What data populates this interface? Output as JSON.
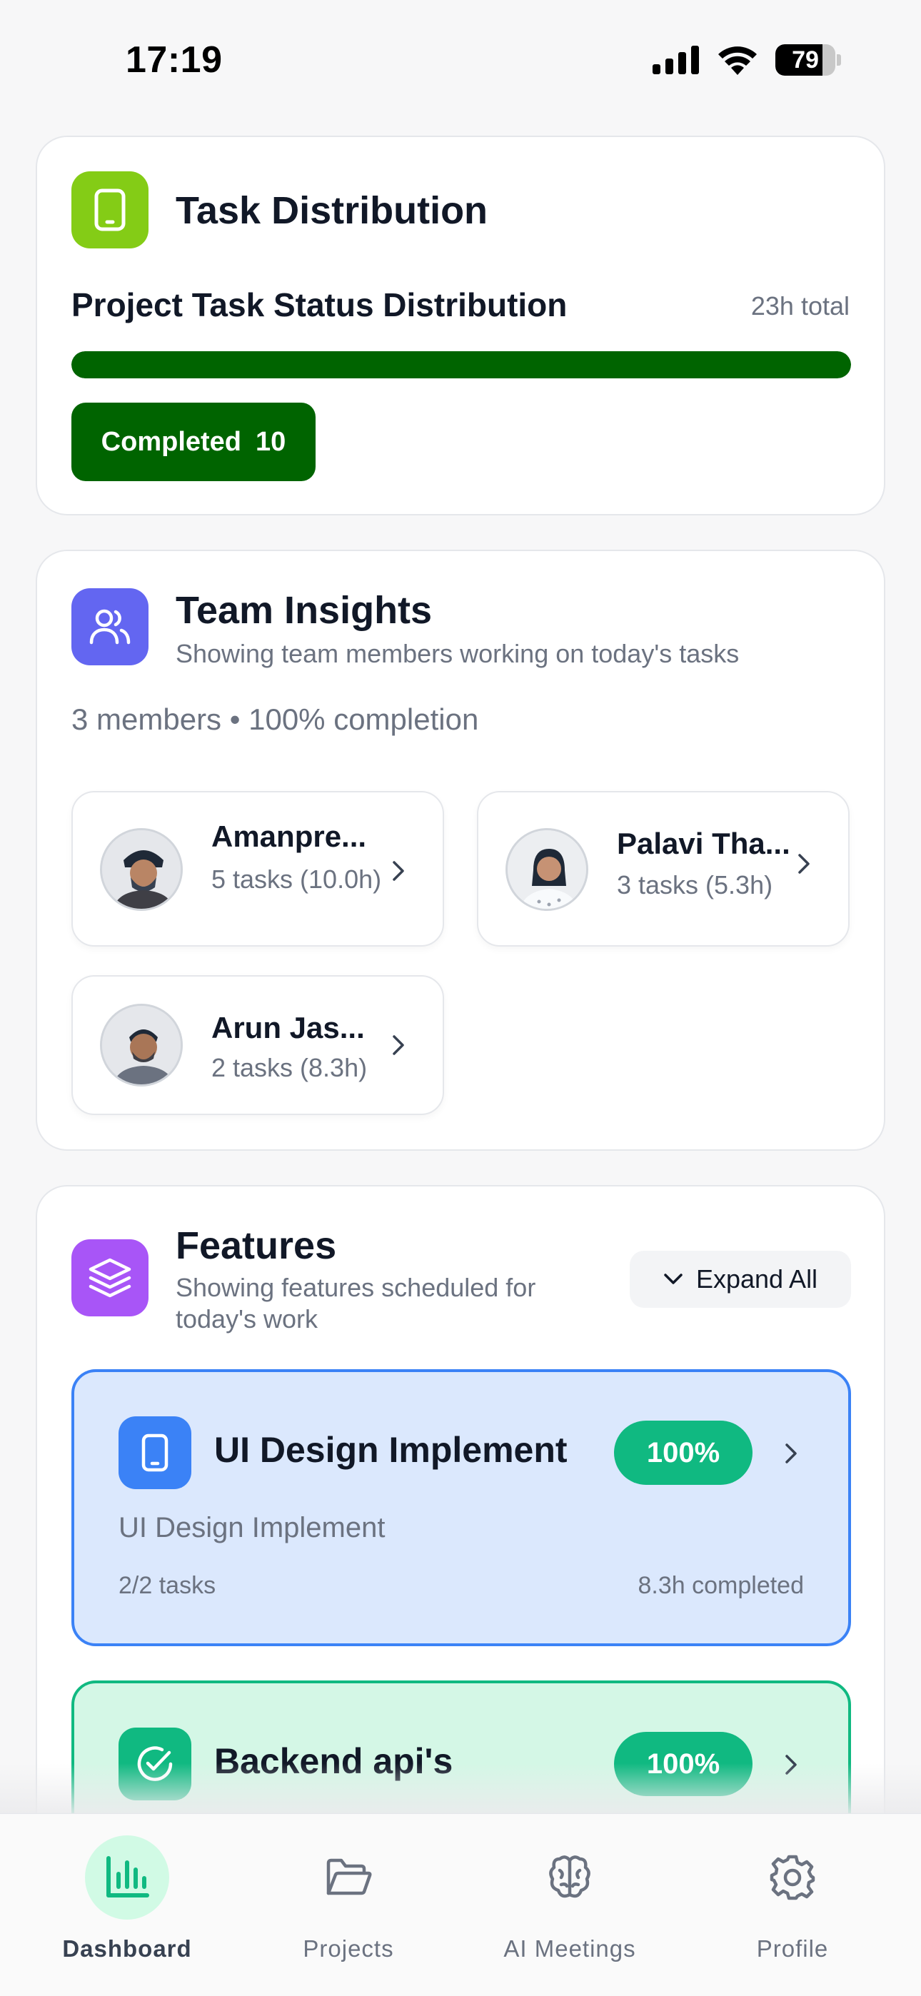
{
  "status_bar": {
    "time": "17:19",
    "battery": "79",
    "battery_level": 0.79
  },
  "task_distribution": {
    "title": "Task Distribution",
    "subtitle": "Project Task Status Distribution",
    "total": "23h total",
    "progress_fraction": 1.0,
    "bar_color": "#006400",
    "badge_label": "Completed",
    "badge_count": "10"
  },
  "team_insights": {
    "title": "Team Insights",
    "subtitle": "Showing team members working on today's tasks",
    "summary": "3 members • 100% completion",
    "members": [
      {
        "name": "Amanpre...",
        "tasks": "5 tasks (10.0h)"
      },
      {
        "name": "Palavi Tha...",
        "tasks": "3 tasks (5.3h)"
      },
      {
        "name": "Arun  Jas...",
        "tasks": "2 tasks (8.3h)"
      }
    ]
  },
  "features": {
    "title": "Features",
    "subtitle": "Showing features scheduled for today's work",
    "expand_label": "Expand All",
    "items": [
      {
        "title": "UI Design Implement",
        "percent": "100%",
        "description": "UI Design Implement",
        "tasks": "2/2 tasks",
        "hours": "8.3h completed",
        "icon": "phone-icon",
        "accent": "#3b82f6"
      },
      {
        "title": "Backend api's",
        "percent": "100%",
        "icon": "check-circle-icon",
        "accent": "#10b981"
      }
    ]
  },
  "tab_bar": {
    "active": "Dashboard",
    "tabs": [
      {
        "label": "Dashboard",
        "icon": "bar-chart-icon"
      },
      {
        "label": "Projects",
        "icon": "folder-open-icon"
      },
      {
        "label": "AI Meetings",
        "icon": "brain-icon"
      },
      {
        "label": "Profile",
        "icon": "gear-icon"
      }
    ]
  },
  "colors": {
    "accent_green": "#10b981",
    "dark_green": "#006400",
    "lime": "#84cc16",
    "indigo": "#6366f1",
    "purple": "#a855f7",
    "blue": "#3b82f6"
  }
}
